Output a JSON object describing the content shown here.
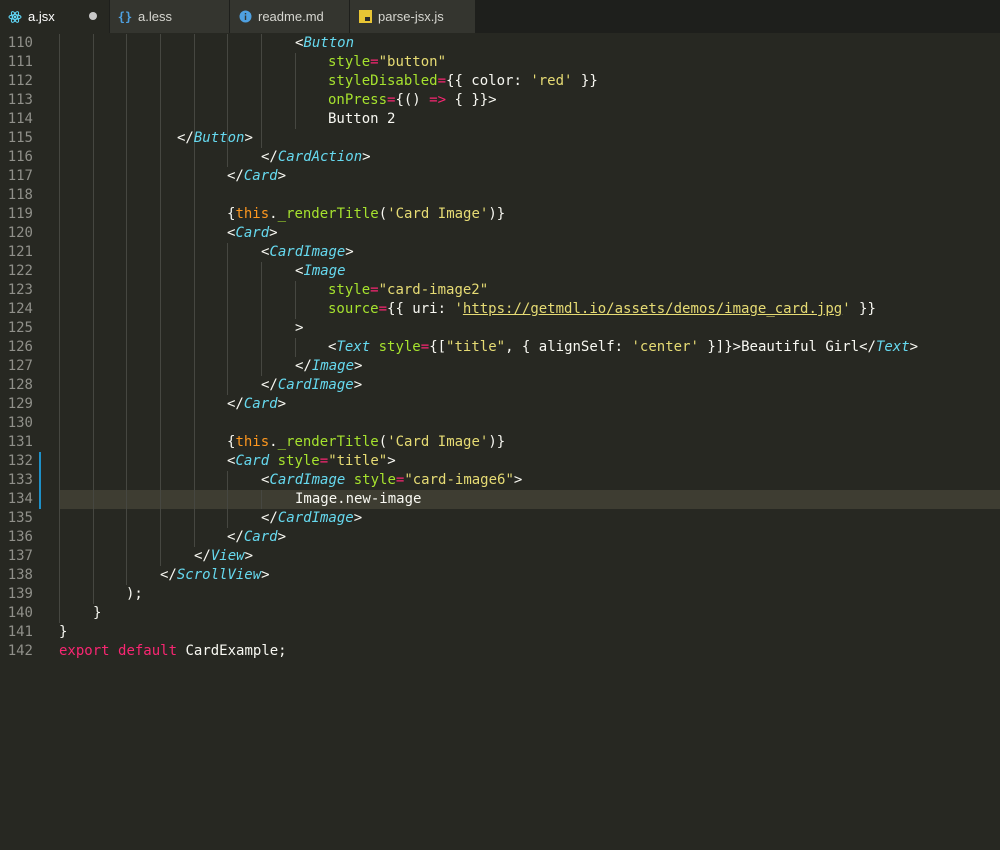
{
  "tabs": [
    {
      "label": "a.jsx",
      "icon": "react-icon",
      "active": true,
      "dirty": true
    },
    {
      "label": "a.less",
      "icon": "braces-icon",
      "active": false
    },
    {
      "label": "readme.md",
      "icon": "info-icon",
      "active": false
    },
    {
      "label": "parse-jsx.js",
      "icon": "js-file-icon",
      "active": false
    }
  ],
  "colors": {
    "background": "#272822",
    "tag": "#66d9ef",
    "attribute": "#a6e22e",
    "string": "#e6db74",
    "keyword": "#f92672",
    "this": "#fd971f",
    "line_number": "#90908a",
    "current_line": "#3e3d32",
    "git_modified": "#1e90c8"
  },
  "editor": {
    "current_line": 134,
    "modified_lines": [
      132,
      133,
      134
    ],
    "lines": [
      {
        "num": "110",
        "guides": 7,
        "segs": [
          [
            "p",
            "<"
          ],
          [
            "t",
            "Button"
          ]
        ]
      },
      {
        "num": "111",
        "guides": 8,
        "segs": [
          [
            "a",
            "style"
          ],
          [
            "o",
            "="
          ],
          [
            "s",
            "\"button\""
          ]
        ]
      },
      {
        "num": "112",
        "guides": 8,
        "segs": [
          [
            "a",
            "styleDisabled"
          ],
          [
            "o",
            "="
          ],
          [
            "p",
            "{{ color: "
          ],
          [
            "s",
            "'red'"
          ],
          [
            "p",
            " }}"
          ]
        ]
      },
      {
        "num": "113",
        "guides": 8,
        "segs": [
          [
            "a",
            "onPress"
          ],
          [
            "o",
            "="
          ],
          [
            "p",
            "{() "
          ],
          [
            "o",
            "=>"
          ],
          [
            "p",
            " { }}>"
          ]
        ]
      },
      {
        "num": "114",
        "guides": 8,
        "segs": [
          [
            "p",
            "Button 2"
          ]
        ]
      },
      {
        "num": "115",
        "guides": 7,
        "col": 14,
        "segs": [
          [
            "p",
            "</"
          ],
          [
            "t",
            "Button"
          ],
          [
            "p",
            ">"
          ]
        ]
      },
      {
        "num": "116",
        "guides": 6,
        "segs": [
          [
            "p",
            "</"
          ],
          [
            "t",
            "CardAction"
          ],
          [
            "p",
            ">"
          ]
        ]
      },
      {
        "num": "117",
        "guides": 5,
        "segs": [
          [
            "p",
            "</"
          ],
          [
            "t",
            "Card"
          ],
          [
            "p",
            ">"
          ]
        ]
      },
      {
        "num": "118",
        "guides": 5,
        "segs": []
      },
      {
        "num": "119",
        "guides": 5,
        "segs": [
          [
            "p",
            "{"
          ],
          [
            "th",
            "this"
          ],
          [
            "p",
            "."
          ],
          [
            "a",
            "_renderTitle"
          ],
          [
            "p",
            "("
          ],
          [
            "s",
            "'Card Image'"
          ],
          [
            "p",
            ")}"
          ]
        ]
      },
      {
        "num": "120",
        "guides": 5,
        "segs": [
          [
            "p",
            "<"
          ],
          [
            "t",
            "Card"
          ],
          [
            "p",
            ">"
          ]
        ]
      },
      {
        "num": "121",
        "guides": 6,
        "segs": [
          [
            "p",
            "<"
          ],
          [
            "t",
            "CardImage"
          ],
          [
            "p",
            ">"
          ]
        ]
      },
      {
        "num": "122",
        "guides": 7,
        "segs": [
          [
            "p",
            "<"
          ],
          [
            "t",
            "Image"
          ]
        ]
      },
      {
        "num": "123",
        "guides": 8,
        "segs": [
          [
            "a",
            "style"
          ],
          [
            "o",
            "="
          ],
          [
            "s",
            "\"card-image2\""
          ]
        ]
      },
      {
        "num": "124",
        "guides": 8,
        "segs": [
          [
            "a",
            "source"
          ],
          [
            "o",
            "="
          ],
          [
            "p",
            "{{ uri: "
          ],
          [
            "s",
            "'"
          ],
          [
            "su",
            "https://getmdl.io/assets/demos/image_card.jpg"
          ],
          [
            "s",
            "'"
          ],
          [
            "p",
            " }}"
          ]
        ]
      },
      {
        "num": "125",
        "guides": 7,
        "segs": [
          [
            "p",
            ">"
          ]
        ]
      },
      {
        "num": "126",
        "guides": 8,
        "segs": [
          [
            "p",
            "<"
          ],
          [
            "t",
            "Text"
          ],
          [
            "p",
            " "
          ],
          [
            "a",
            "style"
          ],
          [
            "o",
            "="
          ],
          [
            "p",
            "{["
          ],
          [
            "s",
            "\"title\""
          ],
          [
            "p",
            ", { alignSelf: "
          ],
          [
            "s",
            "'center'"
          ],
          [
            "p",
            " }]}>Beautiful Girl</"
          ],
          [
            "t",
            "Text"
          ],
          [
            "p",
            ">"
          ]
        ]
      },
      {
        "num": "127",
        "guides": 7,
        "segs": [
          [
            "p",
            "</"
          ],
          [
            "t",
            "Image"
          ],
          [
            "p",
            ">"
          ]
        ]
      },
      {
        "num": "128",
        "guides": 6,
        "segs": [
          [
            "p",
            "</"
          ],
          [
            "t",
            "CardImage"
          ],
          [
            "p",
            ">"
          ]
        ]
      },
      {
        "num": "129",
        "guides": 5,
        "segs": [
          [
            "p",
            "</"
          ],
          [
            "t",
            "Card"
          ],
          [
            "p",
            ">"
          ]
        ]
      },
      {
        "num": "130",
        "guides": 5,
        "segs": []
      },
      {
        "num": "131",
        "guides": 5,
        "segs": [
          [
            "p",
            "{"
          ],
          [
            "th",
            "this"
          ],
          [
            "p",
            "."
          ],
          [
            "a",
            "_renderTitle"
          ],
          [
            "p",
            "("
          ],
          [
            "s",
            "'Card Image'"
          ],
          [
            "p",
            ")}"
          ]
        ]
      },
      {
        "num": "132",
        "guides": 5,
        "segs": [
          [
            "p",
            "<"
          ],
          [
            "t",
            "Card"
          ],
          [
            "p",
            " "
          ],
          [
            "a",
            "style"
          ],
          [
            "o",
            "="
          ],
          [
            "s",
            "\"title\""
          ],
          [
            "p",
            ">"
          ]
        ]
      },
      {
        "num": "133",
        "guides": 6,
        "segs": [
          [
            "p",
            "<"
          ],
          [
            "t",
            "CardImage"
          ],
          [
            "p",
            " "
          ],
          [
            "a",
            "style"
          ],
          [
            "o",
            "="
          ],
          [
            "s",
            "\"card-image6\""
          ],
          [
            "p",
            ">"
          ]
        ]
      },
      {
        "num": "134",
        "guides": 7,
        "segs": [
          [
            "p",
            "Image.new-image"
          ]
        ]
      },
      {
        "num": "135",
        "guides": 6,
        "segs": [
          [
            "p",
            "</"
          ],
          [
            "t",
            "CardImage"
          ],
          [
            "p",
            ">"
          ]
        ]
      },
      {
        "num": "136",
        "guides": 5,
        "segs": [
          [
            "p",
            "</"
          ],
          [
            "t",
            "Card"
          ],
          [
            "p",
            ">"
          ]
        ]
      },
      {
        "num": "137",
        "guides": 4,
        "segs": [
          [
            "p",
            "</"
          ],
          [
            "t",
            "View"
          ],
          [
            "p",
            ">"
          ]
        ]
      },
      {
        "num": "138",
        "guides": 3,
        "segs": [
          [
            "p",
            "</"
          ],
          [
            "t",
            "ScrollView"
          ],
          [
            "p",
            ">"
          ]
        ]
      },
      {
        "num": "139",
        "guides": 2,
        "segs": [
          [
            "p",
            ");"
          ]
        ]
      },
      {
        "num": "140",
        "guides": 1,
        "segs": [
          [
            "p",
            "}"
          ]
        ]
      },
      {
        "num": "141",
        "guides": 0,
        "segs": [
          [
            "p",
            "}"
          ]
        ]
      },
      {
        "num": "142",
        "guides": 0,
        "segs": [
          [
            "k",
            "export"
          ],
          [
            "p",
            " "
          ],
          [
            "k",
            "default"
          ],
          [
            "p",
            " CardExample;"
          ]
        ]
      }
    ]
  }
}
